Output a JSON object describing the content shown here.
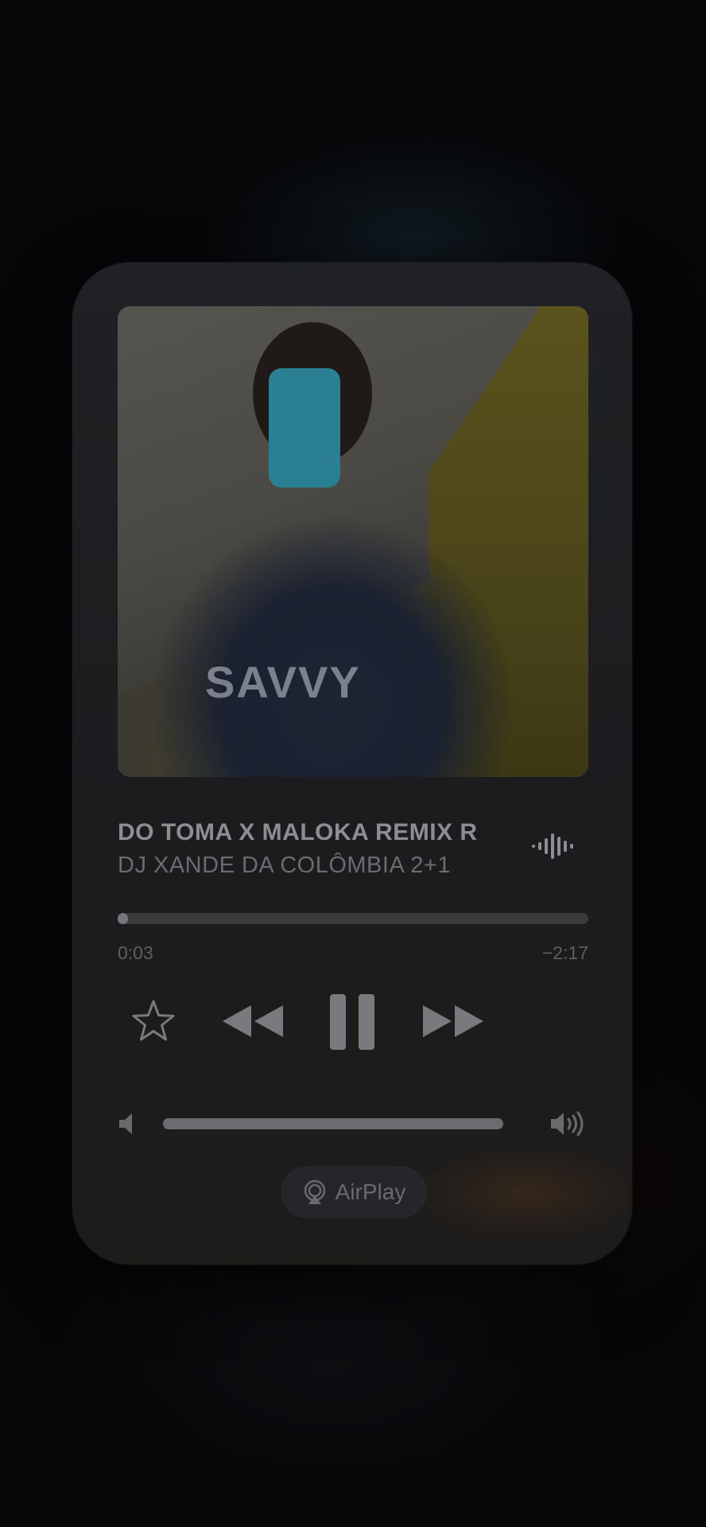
{
  "now_playing": {
    "title": "DO TOMA X MALOKA REMIX R",
    "artist": "DJ XANDE DA COLÔMBIA 2+1",
    "artwork_text": "SAVVY",
    "waveform_icon": "waveform-icon"
  },
  "progress": {
    "elapsed": "0:03",
    "remaining": "−2:17",
    "fraction": 0.022
  },
  "controls": {
    "favorite_icon": "star-icon",
    "previous_icon": "rewind-icon",
    "play_pause_icon": "pause-icon",
    "next_icon": "fast-forward-icon"
  },
  "volume": {
    "level": 1.0,
    "low_icon": "speaker-low-icon",
    "high_icon": "speaker-high-icon"
  },
  "airplay": {
    "label": "AirPlay",
    "icon": "airplay-icon"
  },
  "colors": {
    "background": "#060608",
    "card": "#1f1f22",
    "text_primary": "#8e8e92",
    "text_secondary": "#6b6b70",
    "track": "#3b3b3e"
  }
}
